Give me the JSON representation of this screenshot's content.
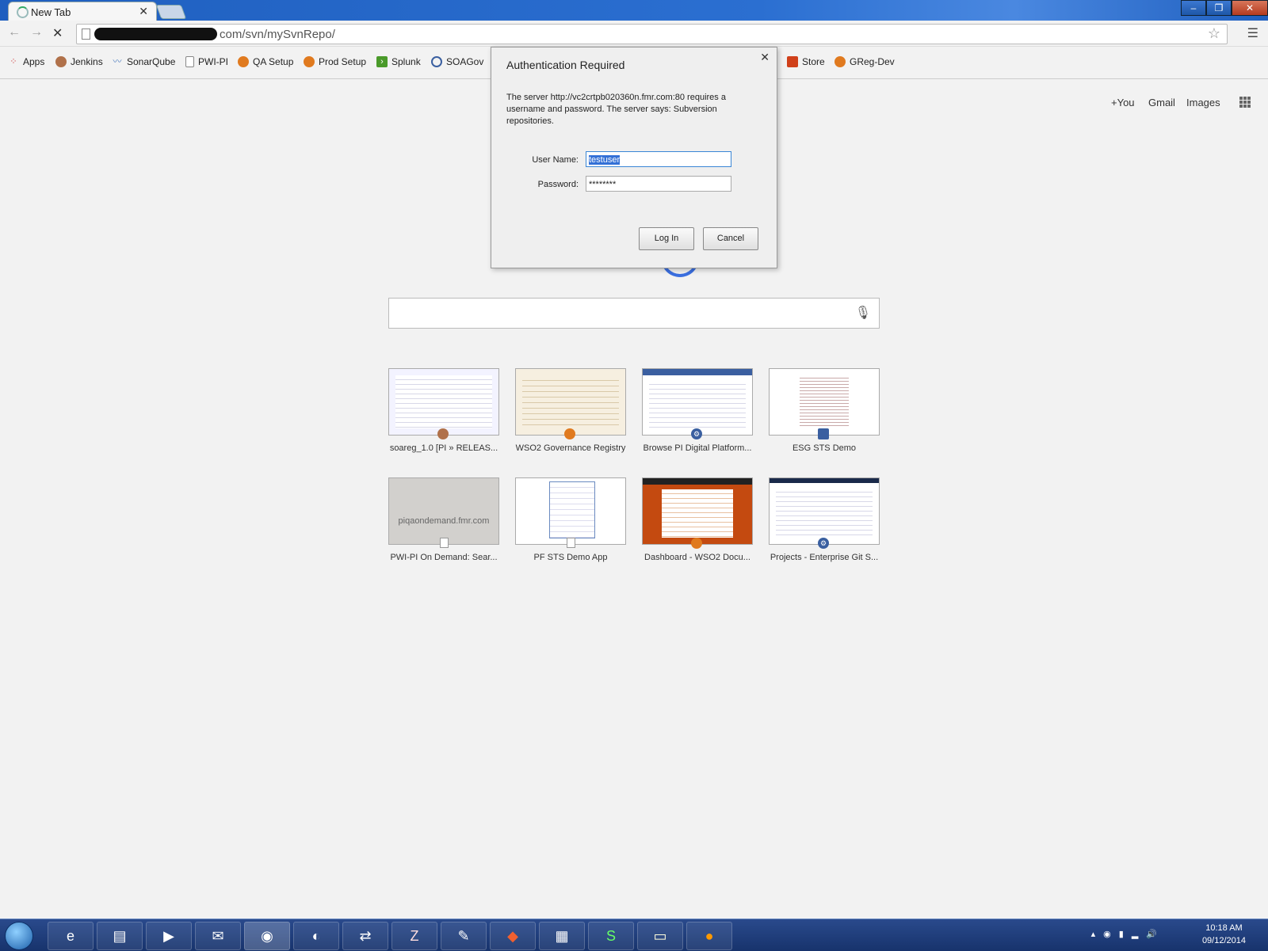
{
  "tab": {
    "title": "New Tab"
  },
  "omnibox": {
    "url_visible": "com/svn/mySvnRepo/"
  },
  "bookmarks": [
    {
      "label": "Apps",
      "icon": "apps-grid-icon",
      "color": "#d04040"
    },
    {
      "label": "Jenkins",
      "icon": "jenkins-icon",
      "color": "#b0714a"
    },
    {
      "label": "SonarQube",
      "icon": "sonarqube-icon",
      "color": "#4b7bbf"
    },
    {
      "label": "PWI-PI",
      "icon": "page-icon",
      "color": "#888888"
    },
    {
      "label": "QA Setup",
      "icon": "wso2-icon",
      "color": "#e07a1f"
    },
    {
      "label": "Prod Setup",
      "icon": "wso2-icon",
      "color": "#e07a1f"
    },
    {
      "label": "Splunk",
      "icon": "splunk-icon",
      "color": "#4a9a2a"
    },
    {
      "label": "SOAGov",
      "icon": "soagov-icon",
      "color": "#3a5fa0"
    },
    {
      "label": "Store",
      "icon": "store-icon",
      "color": "#d0401a"
    },
    {
      "label": "GReg-Dev",
      "icon": "wso2-icon",
      "color": "#e07a1f"
    }
  ],
  "top_links": [
    "+You",
    "Gmail",
    "Images"
  ],
  "tiles": [
    {
      "label": "soareg_1.0 [PI » RELEAS...",
      "thumb_text": "",
      "badge": "jenkins",
      "badge_color": "#b0714a"
    },
    {
      "label": "WSO2 Governance Registry",
      "thumb_text": "",
      "badge": "wso2",
      "badge_color": "#e07a1f"
    },
    {
      "label": "Browse PI Digital Platform...",
      "thumb_text": "",
      "badge": "gear",
      "badge_color": "#3a5fa0"
    },
    {
      "label": "ESG STS Demo",
      "thumb_text": "",
      "badge": "esg",
      "badge_color": "#3a5fa0"
    },
    {
      "label": "PWI-PI On Demand: Sear...",
      "thumb_text": "piqaondemand.fmr.com",
      "badge": "page",
      "badge_color": "#999999"
    },
    {
      "label": "PF STS Demo App",
      "thumb_text": "",
      "badge": "page",
      "badge_color": "#999999"
    },
    {
      "label": "Dashboard - WSO2 Docu...",
      "thumb_text": "",
      "badge": "wso2",
      "badge_color": "#e07a1f"
    },
    {
      "label": "Projects - Enterprise Git S...",
      "thumb_text": "",
      "badge": "gear",
      "badge_color": "#3a5fa0"
    }
  ],
  "dialog": {
    "title": "Authentication Required",
    "message": "The server http://vc2crtpb020360n.fmr.com:80 requires a username and password. The server says: Subversion repositories.",
    "username_label": "User Name:",
    "username_value": "testuser",
    "password_label": "Password:",
    "password_value": "********",
    "login_label": "Log In",
    "cancel_label": "Cancel"
  },
  "taskbar": {
    "items": [
      "ie",
      "explorer",
      "media-player",
      "outlook",
      "chrome",
      "firefox",
      "network",
      "filezilla",
      "notepad-plus",
      "git",
      "server",
      "sync",
      "folder",
      "chat"
    ],
    "time": "10:18 AM",
    "date": "09/12/2014"
  }
}
